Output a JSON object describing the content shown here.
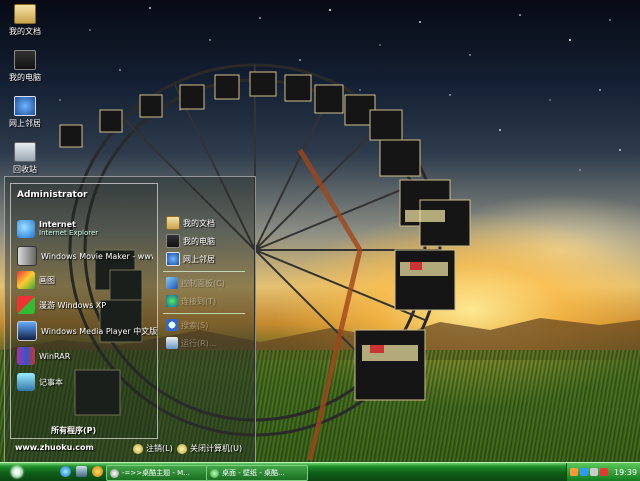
{
  "desktop_icons": [
    {
      "label": "我的文档",
      "icon": "my-documents-icon"
    },
    {
      "label": "我的电脑",
      "icon": "my-computer-icon"
    },
    {
      "label": "网上邻居",
      "icon": "network-places-icon"
    },
    {
      "label": "回收站",
      "icon": "recycle-bin-icon"
    }
  ],
  "start_menu": {
    "user_name": "Administrator",
    "pinned": [
      {
        "label": "Internet",
        "sub": "Internet Explorer",
        "icon": "internet-explorer-icon"
      },
      {
        "label": "Windows Movie Maker - www.zhuoku.com",
        "sub": "",
        "icon": "movie-maker-icon"
      },
      {
        "label": "画图",
        "sub": "",
        "icon": "paint-icon"
      },
      {
        "label": "漫游 Windows XP",
        "sub": "",
        "icon": "windows-tour-icon"
      },
      {
        "label": "Windows Media Player 中文版",
        "sub": "",
        "icon": "media-player-icon"
      },
      {
        "label": "WinRAR",
        "sub": "",
        "icon": "winrar-icon"
      },
      {
        "label": "记事本",
        "sub": "",
        "icon": "notepad-icon"
      }
    ],
    "all_programs": "所有程序(P)",
    "site_url": "www.zhuoku.com",
    "right_items": [
      {
        "label": "我的文档",
        "icon": "my-documents-icon"
      },
      {
        "label": "我的电脑",
        "icon": "my-computer-icon"
      },
      {
        "label": "网上邻居",
        "icon": "network-places-icon"
      },
      {
        "label": "控制面板(C)",
        "icon": "control-panel-icon"
      },
      {
        "label": "连接到(T)",
        "icon": "connect-to-icon"
      },
      {
        "label": "搜索(S)",
        "icon": "search-icon"
      },
      {
        "label": "运行(R)...",
        "icon": "run-icon"
      }
    ],
    "logoff": "注销(L)",
    "shutdown": "关闭计算机(U)"
  },
  "taskbar": {
    "tasks": [
      {
        "label": "-=>>桌酷主题 - M...",
        "icon": "media-task-icon"
      },
      {
        "label": "桌面 - 壁纸 - 桌酷...",
        "icon": "browser-task-icon"
      }
    ],
    "clock": "19:39"
  }
}
